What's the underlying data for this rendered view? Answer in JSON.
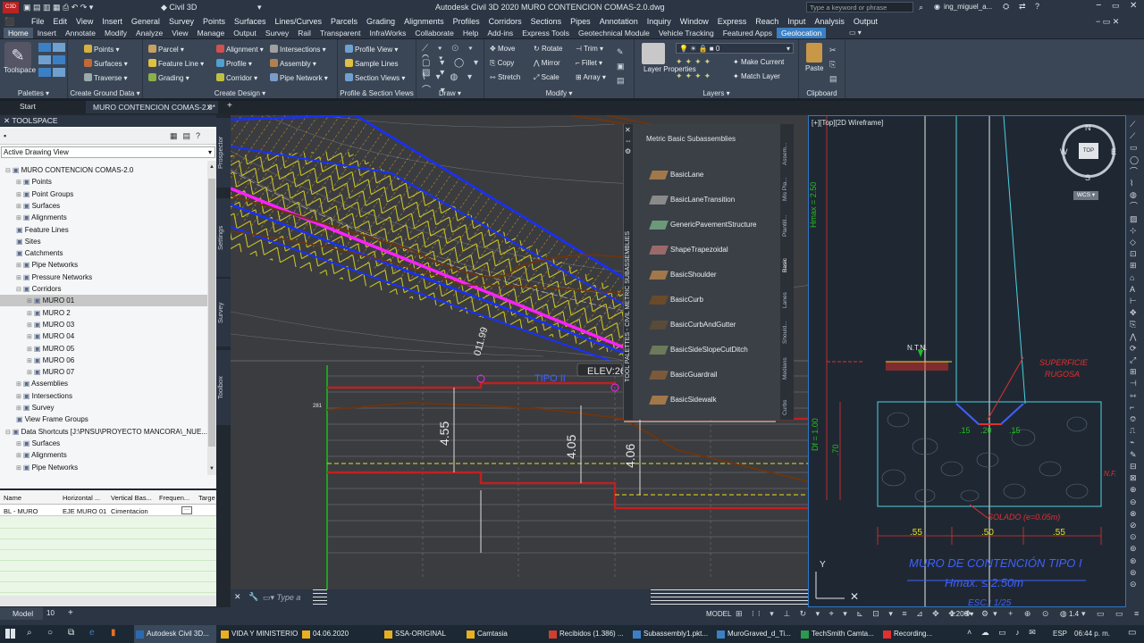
{
  "title_bar": {
    "app_menu": "Civil 3D",
    "workspace": "Civil 3D",
    "title": "Autodesk Civil 3D 2020   MURO CONTENCION COMAS-2.0.dwg",
    "search_placeholder": "Type a keyword or phrase",
    "user": "ing_miguel_a..."
  },
  "menubar": [
    "File",
    "Edit",
    "View",
    "Insert",
    "General",
    "Survey",
    "Points",
    "Surfaces",
    "Lines/Curves",
    "Parcels",
    "Grading",
    "Alignments",
    "Profiles",
    "Corridors",
    "Sections",
    "Pipes",
    "Annotation",
    "Inquiry",
    "Window",
    "Express",
    "Reach",
    "Input",
    "Analysis",
    "Output"
  ],
  "ribbon_tabs": [
    "Home",
    "Insert",
    "Annotate",
    "Modify",
    "Analyze",
    "View",
    "Manage",
    "Output",
    "Survey",
    "Rail",
    "Transparent",
    "InfraWorks",
    "Collaborate",
    "Help",
    "Add-ins",
    "Express Tools",
    "Geotechnical Module",
    "Vehicle Tracking",
    "Featured Apps",
    "Geolocation"
  ],
  "active_tab": "Home",
  "ribbon": {
    "palettes": {
      "toolspace": "Toolspace",
      "label": "Palettes"
    },
    "ground": {
      "items": [
        "Points",
        "Surfaces",
        "Traverse"
      ],
      "label": "Create Ground Data"
    },
    "design": {
      "items": [
        "Parcel",
        "Feature Line",
        "Grading",
        "Alignment",
        "Profile",
        "Corridor",
        "Intersections",
        "Assembly",
        "Pipe Network"
      ],
      "label": "Create Design"
    },
    "profile": {
      "items": [
        "Profile View",
        "Sample Lines",
        "Section Views"
      ],
      "label": "Profile & Section Views"
    },
    "draw": {
      "label": "Draw"
    },
    "modify": {
      "items": [
        "Move",
        "Rotate",
        "Trim",
        "Copy",
        "Mirror",
        "Fillet",
        "Stretch",
        "Scale",
        "Array"
      ],
      "label": "Modify"
    },
    "layers": {
      "layer_properties": "Layer Properties",
      "current_layer": "0",
      "make_current": "Make Current",
      "match_layer": "Match Layer",
      "label": "Layers"
    },
    "clipboard": {
      "paste": "Paste",
      "label": "Clipboard"
    }
  },
  "doc_tabs": {
    "start": "Start",
    "active": "MURO CONTENCION COMAS-2.0*"
  },
  "toolspace": {
    "header": "TOOLSPACE",
    "view_select": "Active Drawing View",
    "root": "MURO CONTENCION COMAS-2.0",
    "items": [
      "Points",
      "Point Groups",
      "Surfaces",
      "Alignments",
      "Feature Lines",
      "Sites",
      "Catchments",
      "Pipe Networks",
      "Pressure Networks",
      "Corridors"
    ],
    "corridors": [
      "MURO 01",
      "MURO 2",
      "MURO 03",
      "MURO 04",
      "MURO 05",
      "MURO 06",
      "MURO 07"
    ],
    "items2": [
      "Assemblies",
      "Intersections",
      "Survey",
      "View Frame Groups"
    ],
    "shortcuts": "Data Shortcuts [J:\\PNSU\\PROYECTO MANCORA\\_NUE...",
    "shortcut_items": [
      "Surfaces",
      "Alignments",
      "Pipe Networks"
    ],
    "side_tabs": [
      "Prospector",
      "Settings",
      "Survey",
      "Toolbox"
    ]
  },
  "grid": {
    "headers": [
      "Name",
      "Horizontal ...",
      "Vertical Bas...",
      "Frequen...",
      "Targe"
    ],
    "row": [
      "BL - MURO",
      "EJE MURO 01",
      "Cimentacion",
      ""
    ]
  },
  "tool_palette": {
    "title": "Metric Basic Subassemblies",
    "side_title": "TOOL PALETTES - CIVIL METRIC SUBASSEMBLIES",
    "items": [
      "BasicLane",
      "BasicLaneTransition",
      "GenericPavementStructure",
      "ShapeTrapezoidal",
      "BasicShoulder",
      "BasicCurb",
      "BasicCurbAndGutter",
      "BasicSideSlopeCutDitch",
      "BasicGuardrail",
      "BasicSidewalk"
    ],
    "tabs": [
      "Assem...",
      "Mis Pla...",
      "Plantill...",
      "Basic",
      "Lanes",
      "Should...",
      "Medians",
      "Curbs"
    ]
  },
  "drawing": {
    "elev_label": "ELEV:26",
    "tipo_label": "TIPO II",
    "dim1": "4.55",
    "dim2": "4.05",
    "dim3": "4.06",
    "station": "011.99",
    "num": "281"
  },
  "viewport2": {
    "label": "[+][Top][2D Wireframe]",
    "north": "N",
    "south": "S",
    "east": "E",
    "west": "W",
    "cube": "TOP",
    "wcs": "WCS",
    "hmax_vert": "Hmax = 2.50",
    "ntn": "N.T.N.",
    "superficie": "SUPERFICIE",
    "rugosa": "RUGOSA",
    "df": "Df = 1.00",
    "d70": ".70",
    "dims": [
      ".15",
      ".20",
      ".15"
    ],
    "solado": "SOLADO (e=0.05m)",
    "bottom_dims": [
      ".55",
      ".50",
      ".55"
    ],
    "title1": "MURO DE CONTENCIÓN TIPO I",
    "title2": "Hmax. ≤ 2.50m",
    "title3": "ESC.: 1/25",
    "nf": "N.F."
  },
  "command_placeholder": "Type a command",
  "status": {
    "model_tab": "Model",
    "layout_tab": "10",
    "model": "MODEL",
    "scale": "1:200",
    "zoom": "1.4"
  },
  "taskbar": {
    "apps": [
      "Autodesk Civil 3D...",
      "VIDA Y MINISTERIO",
      "04.06.2020",
      "SSA-ORIGINAL",
      "Camtasia",
      "Recibidos (1.386) ...",
      "Subassembly1.pkt...",
      "MuroGraved_d_Ti...",
      "TechSmith Camta...",
      "Recording..."
    ],
    "lang": "ESP",
    "time": "06:44 p. m."
  },
  "colors": {
    "accent": "#3b80c5",
    "vp_border": "#2e78c8",
    "cyan": "#4fd0e0",
    "red": "#e03030",
    "yellow": "#e8e020",
    "magenta": "#ff20ff",
    "blue": "#1830ff"
  }
}
